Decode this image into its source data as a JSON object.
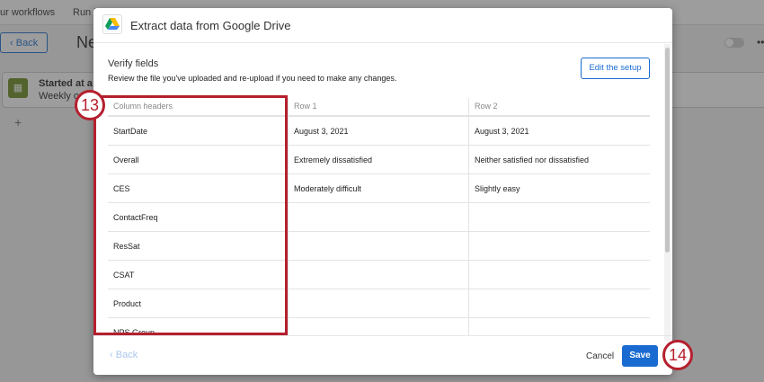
{
  "background": {
    "nav": [
      "ur workflows",
      "Run h"
    ],
    "back_label": "Back",
    "page_title_partial": "Ne",
    "card_title": "Started at a sp",
    "card_sub": "Weekly on",
    "plus": "+",
    "more": "••"
  },
  "modal": {
    "title": "Extract data from Google Drive",
    "section_title": "Verify fields",
    "section_desc": "Review the file you've uploaded and re-upload if you need to make any changes.",
    "edit_button": "Edit the setup",
    "columns": [
      "Column headers",
      "Row 1",
      "Row 2"
    ],
    "rows": [
      [
        "StartDate",
        "August 3, 2021",
        "August 3, 2021"
      ],
      [
        "Overall",
        "Extremely dissatisfied",
        "Neither satisfied nor dissatisfied"
      ],
      [
        "CES",
        "Moderately difficult",
        "Slightly easy"
      ],
      [
        "ContactFreq",
        "",
        ""
      ],
      [
        "ResSat",
        "",
        ""
      ],
      [
        "CSAT",
        "",
        ""
      ],
      [
        "Product",
        "",
        ""
      ],
      [
        "NPS Group",
        "",
        ""
      ]
    ],
    "back_label": "Back",
    "cancel_label": "Cancel",
    "save_label": "Save"
  },
  "annotations": [
    "13",
    "14"
  ],
  "colors": {
    "accent": "#1a6bd1",
    "annotation": "#b5202e"
  }
}
